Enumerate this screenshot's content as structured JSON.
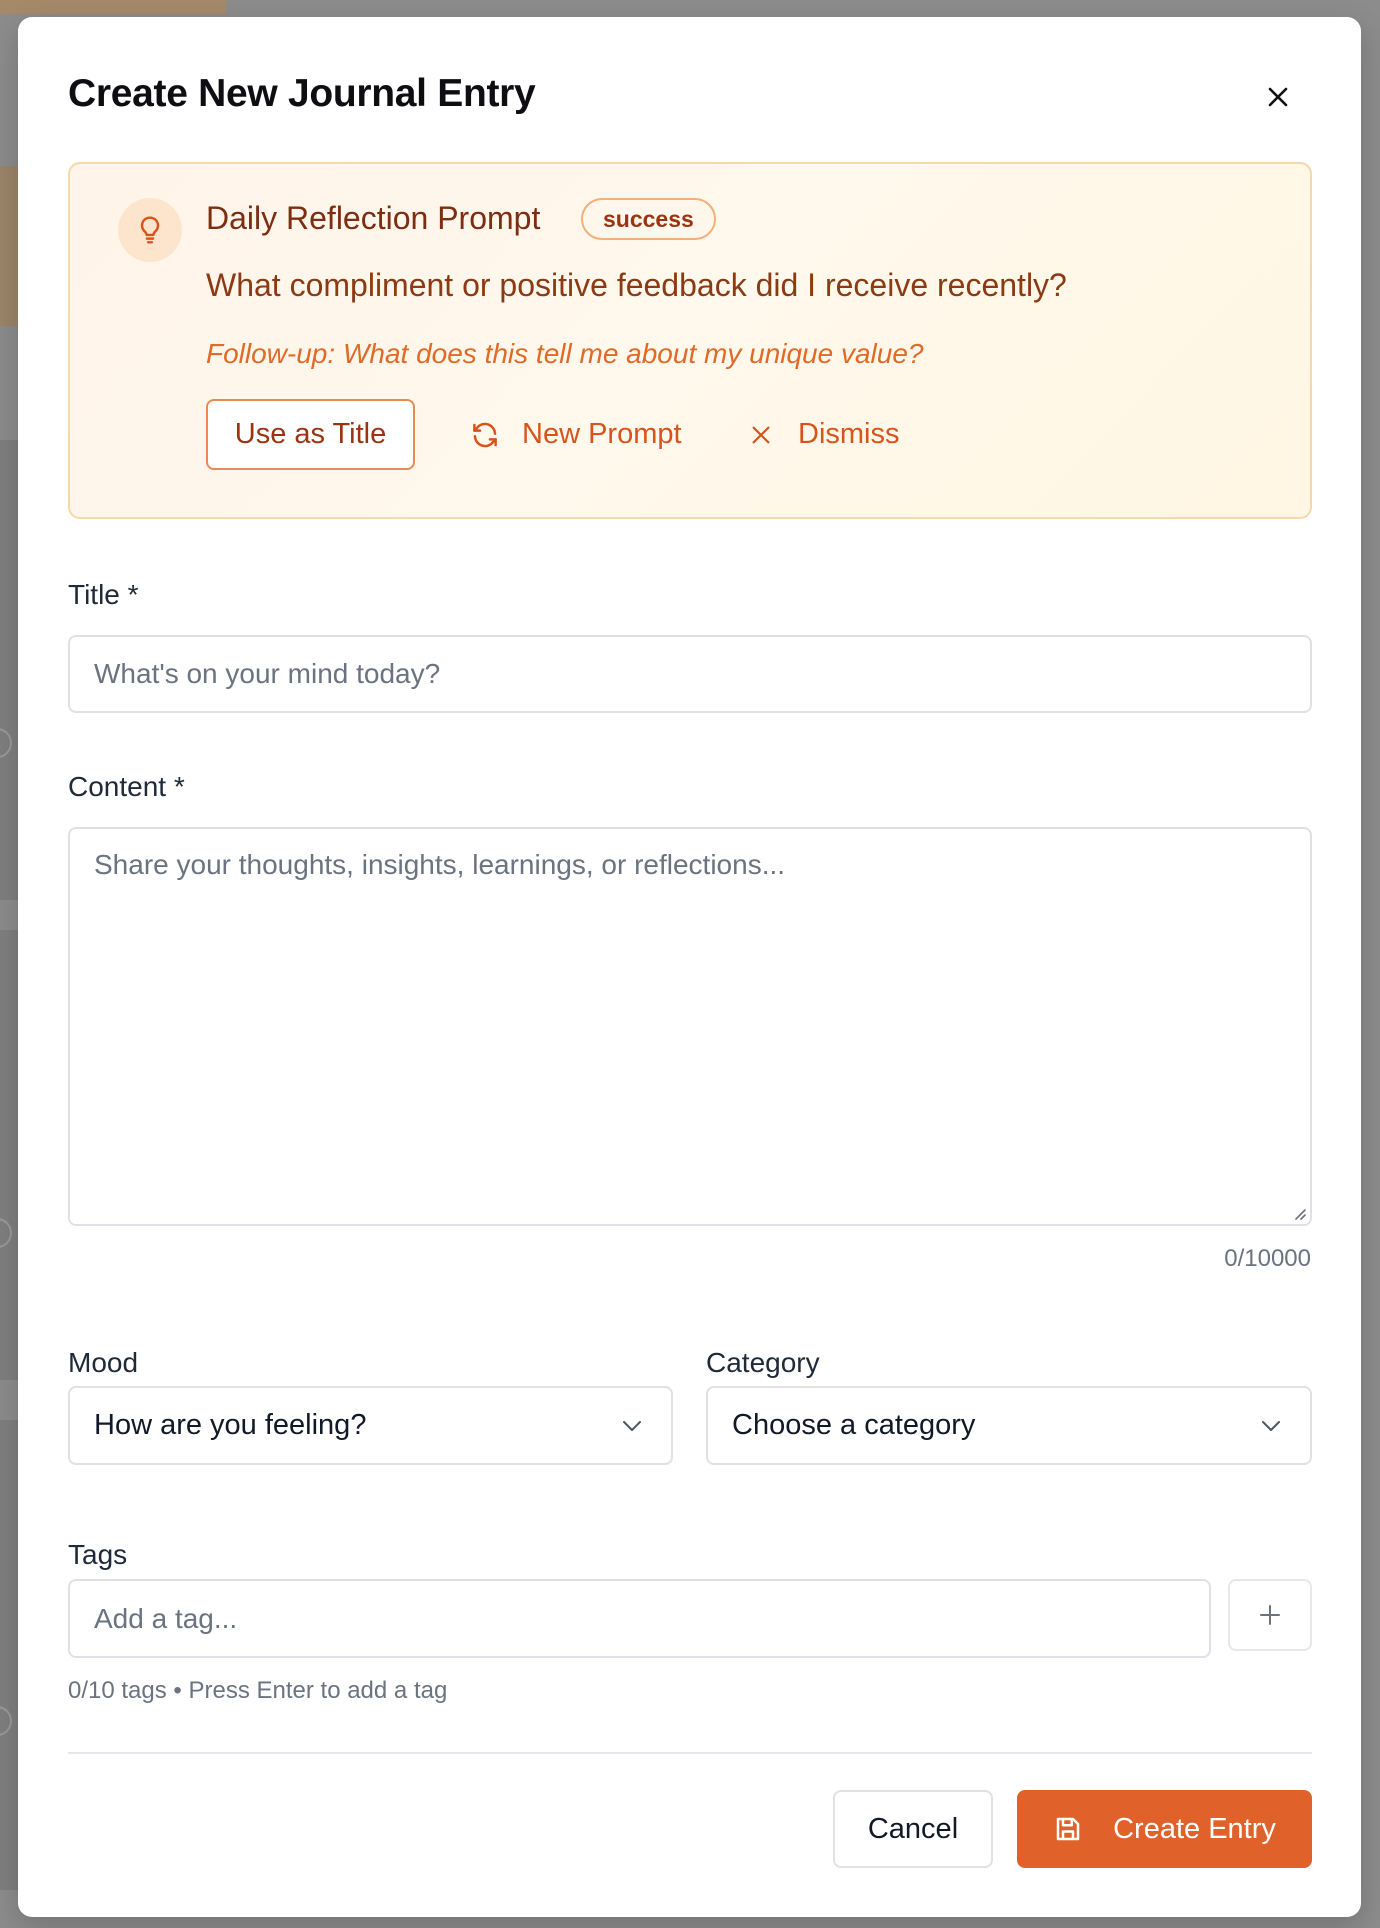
{
  "colors": {
    "accent": "#e0622a",
    "prompt_border": "#f6d8aa",
    "prompt_text": "#7c2d12",
    "followup_text": "#e06a26"
  },
  "modal": {
    "title": "Create New Journal Entry",
    "close_icon": "close-icon"
  },
  "prompt": {
    "icon": "lightbulb-icon",
    "heading": "Daily Reflection Prompt",
    "badge": "success",
    "question": "What compliment or positive feedback did I receive recently?",
    "followup": "Follow-up: What does this tell me about my unique value?",
    "use_as_title_label": "Use as Title",
    "new_prompt_label": "New Prompt",
    "new_prompt_icon": "refresh-icon",
    "dismiss_label": "Dismiss",
    "dismiss_icon": "x-icon"
  },
  "form": {
    "title_label": "Title *",
    "title_placeholder": "What's on your mind today?",
    "content_label": "Content *",
    "content_placeholder": "Share your thoughts, insights, learnings, or reflections...",
    "content_counter": "0/10000",
    "mood_label": "Mood",
    "mood_value": "How are you feeling?",
    "category_label": "Category",
    "category_value": "Choose a category",
    "tags_label": "Tags",
    "tags_placeholder": "Add a tag...",
    "tags_helper": "0/10 tags • Press Enter to add a tag"
  },
  "footer": {
    "cancel_label": "Cancel",
    "create_label": "Create Entry",
    "create_icon": "save-icon"
  }
}
